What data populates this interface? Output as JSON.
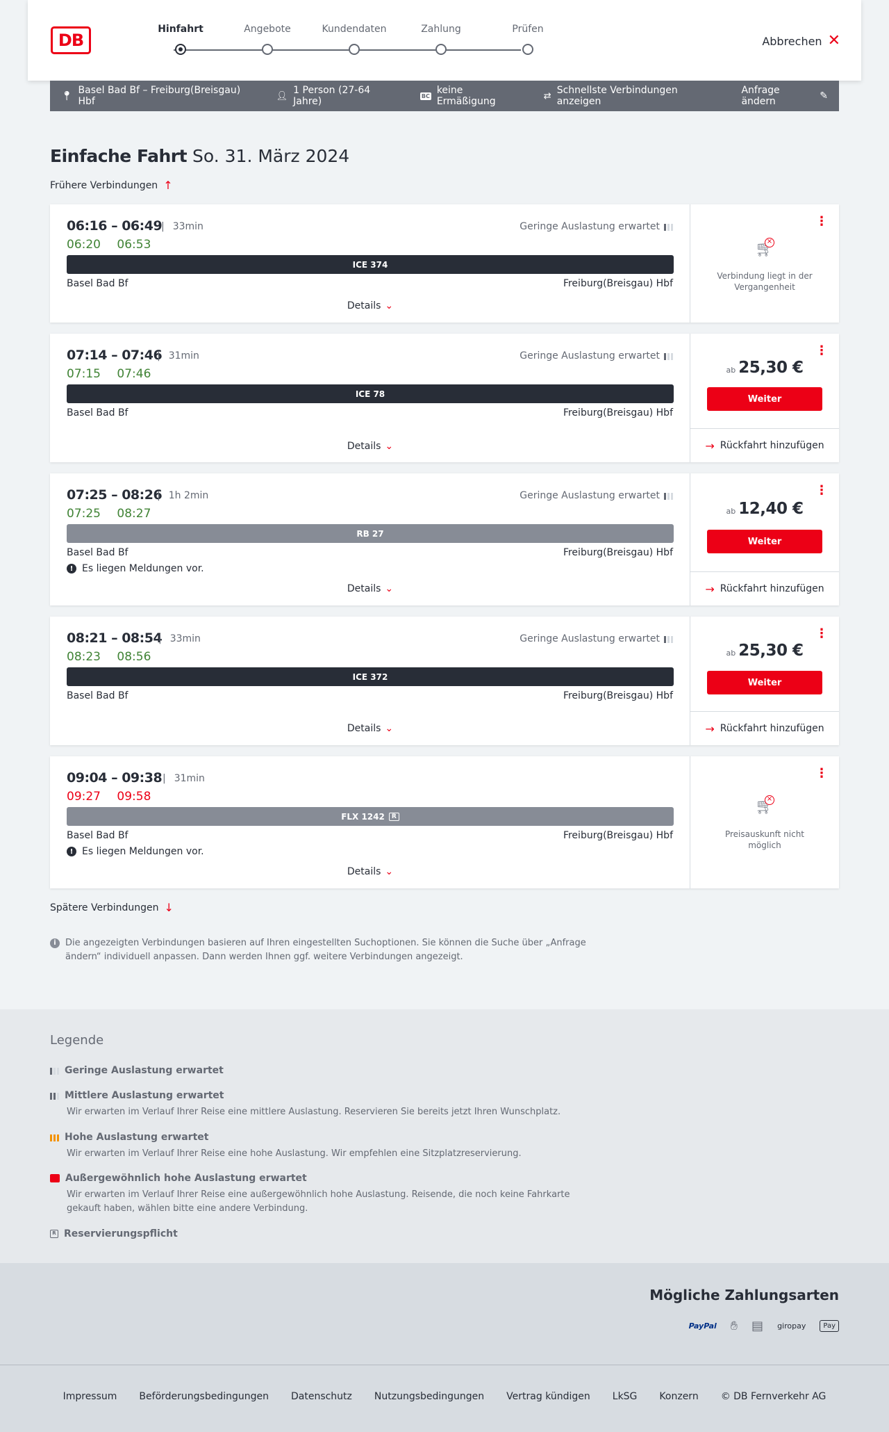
{
  "header": {
    "logo": "DB",
    "steps": [
      "Hinfahrt",
      "Angebote",
      "Kundendaten",
      "Zahlung",
      "Prüfen"
    ],
    "cancel": "Abbrechen"
  },
  "search": {
    "route": "Basel Bad Bf – Freiburg(Breisgau) Hbf",
    "travellers": "1 Person (27-64 Jahre)",
    "bc_badge": "BC",
    "discount": "keine Ermäßigung",
    "fastest": "Schnellste Verbindungen anzeigen",
    "change": "Anfrage ändern"
  },
  "title": {
    "main": "Einfache Fahrt",
    "date": "So. 31. März 2024"
  },
  "earlier": "Frühere Verbindungen",
  "later": "Spätere Verbindungen",
  "connections": [
    {
      "times": "06:16 – 06:49",
      "duration": "33min",
      "realtime": "06:20 06:53",
      "late": false,
      "load": "Geringe Auslastung erwartet",
      "train": "ICE 374",
      "from": "Basel Bad Bf",
      "to": "Freiburg(Breisgau) Hbf",
      "details": "Details",
      "unavailable": "Verbindung liegt in der Vergangenheit"
    },
    {
      "times": "07:14 – 07:46",
      "duration": "31min",
      "realtime": "07:15 07:46",
      "late": false,
      "load": "Geringe Auslastung erwartet",
      "train": "ICE 78",
      "from": "Basel Bad Bf",
      "to": "Freiburg(Breisgau) Hbf",
      "details": "Details",
      "price_prefix": "ab",
      "price": "25,30 €",
      "cta": "Weiter",
      "return": "Rückfahrt hinzufügen"
    },
    {
      "times": "07:25 – 08:26",
      "duration": "1h 2min",
      "realtime": "07:25 08:27",
      "late": false,
      "load": "Geringe Auslastung erwartet",
      "train": "RB 27",
      "from": "Basel Bad Bf",
      "to": "Freiburg(Breisgau) Hbf",
      "notice": "Es liegen Meldungen vor.",
      "details": "Details",
      "price_prefix": "ab",
      "price": "12,40 €",
      "cta": "Weiter",
      "return": "Rückfahrt hinzufügen"
    },
    {
      "times": "08:21 – 08:54",
      "duration": "33min",
      "realtime": "08:23 08:56",
      "late": false,
      "load": "Geringe Auslastung erwartet",
      "train": "ICE 372",
      "from": "Basel Bad Bf",
      "to": "Freiburg(Breisgau) Hbf",
      "details": "Details",
      "price_prefix": "ab",
      "price": "25,30 €",
      "cta": "Weiter",
      "return": "Rückfahrt hinzufügen"
    },
    {
      "times": "09:04 – 09:38",
      "duration": "31min",
      "realtime": "09:27 09:58",
      "late": true,
      "train": "FLX 1242",
      "train_badge": "R",
      "from": "Basel Bad Bf",
      "to": "Freiburg(Breisgau) Hbf",
      "notice": "Es liegen Meldungen vor.",
      "details": "Details",
      "unavailable": "Preisauskunft nicht möglich"
    }
  ],
  "info": "Die angezeigten Verbindungen basieren auf Ihren eingestellten Suchoptionen. Sie können die Suche über „Anfrage ändern“ individuell anpassen. Dann werden Ihnen ggf. weitere Verbindungen angezeigt.",
  "legend": {
    "title": "Legende",
    "items": [
      {
        "title": "Geringe Auslastung erwartet",
        "desc": ""
      },
      {
        "title": "Mittlere Auslastung erwartet",
        "desc": "Wir erwarten im Verlauf Ihrer Reise eine mittlere Auslastung. Reservieren Sie bereits jetzt Ihren Wunschplatz."
      },
      {
        "title": "Hohe Auslastung erwartet",
        "desc": "Wir erwarten im Verlauf Ihrer Reise eine hohe Auslastung. Wir empfehlen eine Sitzplatzreservierung."
      },
      {
        "title": "Außergewöhnlich hohe Auslastung erwartet",
        "desc": "Wir erwarten im Verlauf Ihrer Reise eine außergewöhnlich hohe Auslastung. Reisende, die noch keine Fahrkarte gekauft haben, wählen bitte eine andere Verbindung."
      },
      {
        "title": "Reservierungspflicht",
        "desc": "",
        "badge": "R"
      }
    ]
  },
  "payment": {
    "title": "Mögliche Zahlungsarten",
    "methods": [
      "PayPal",
      "giropay",
      "Pay"
    ]
  },
  "footer": [
    "Impressum",
    "Beförderungsbedingungen",
    "Datenschutz",
    "Nutzungsbedingungen",
    "Vertrag kündigen",
    "LkSG",
    "Konzern",
    "© DB Fernverkehr AG"
  ],
  "colors": {
    "brand": "#ec0016",
    "ontime": "#408335",
    "dark": "#282d37"
  }
}
